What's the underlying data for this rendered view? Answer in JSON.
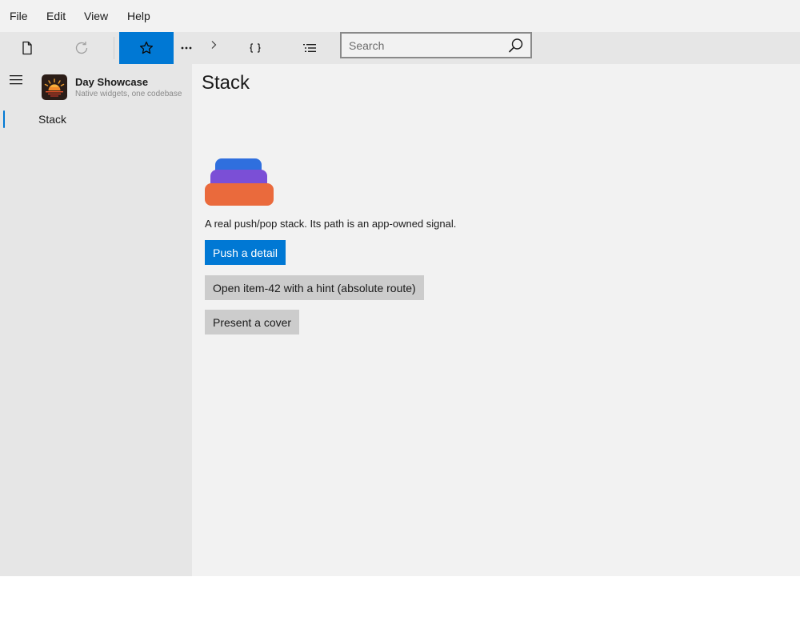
{
  "menubar": {
    "items": [
      "File",
      "Edit",
      "View",
      "Help"
    ]
  },
  "toolbar": {
    "buttons": [
      {
        "icon": "document-icon"
      },
      {
        "icon": "refresh-icon",
        "disabled": true
      },
      {
        "icon": "star-icon",
        "active": true
      },
      {
        "icon": "more-icon"
      },
      {
        "icon": "chevron-right-icon"
      },
      {
        "icon": "braces-icon"
      },
      {
        "icon": "list-icon"
      }
    ],
    "search": {
      "placeholder": "Search",
      "value": ""
    }
  },
  "sidebar": {
    "app_title": "Day Showcase",
    "app_subtitle": "Native widgets, one codebase",
    "items": [
      {
        "label": "Stack",
        "selected": true
      }
    ]
  },
  "main": {
    "title": "Stack",
    "description": "A real push/pop stack. Its path is an app-owned signal.",
    "buttons": {
      "push": "Push a detail",
      "open": "Open item-42 with a hint (absolute route)",
      "cover": "Present a cover"
    }
  },
  "colors": {
    "accent": "#0078d4",
    "stack_top": "#2f6fde",
    "stack_middle": "#7b4fd6",
    "stack_bottom": "#ea6a3c"
  }
}
